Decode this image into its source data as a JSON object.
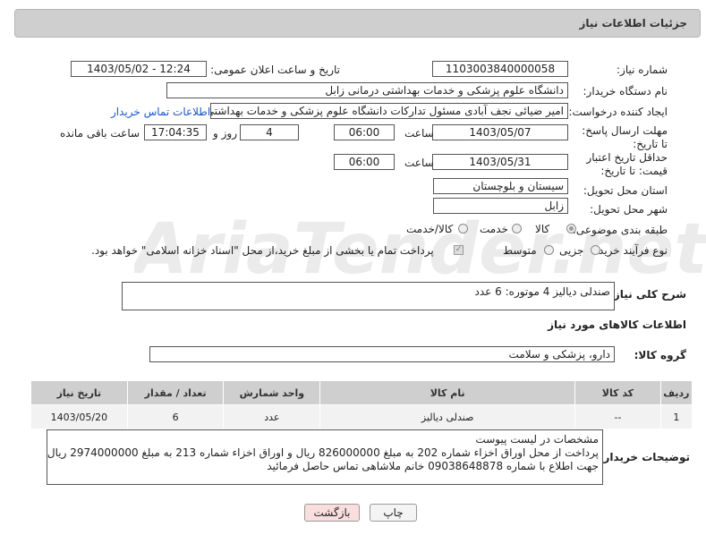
{
  "header": {
    "title": "جزئیات اطلاعات نیاز"
  },
  "fields": {
    "need_number_label": "شماره نیاز:",
    "need_number": "1103003840000058",
    "announce_label": "تاریخ و ساعت اعلان عمومی:",
    "announce_value": "1403/05/02 - 12:24",
    "buyer_org_label": "نام دستگاه خریدار:",
    "buyer_org": "دانشگاه علوم پزشکی و خدمات بهداشتی درمانی زابل",
    "creator_label": "ایجاد کننده درخواست:",
    "creator": "امیر ضیائی نجف آبادی مسئول تدارکات  دانشگاه علوم پزشکی و خدمات بهداشتی درمانی زابل",
    "contact_link": "اطلاعات تماس خریدار",
    "deadline_label": "مهلت ارسال پاسخ: تا تاریخ:",
    "deadline_date": "1403/05/07",
    "time_label": "ساعت",
    "deadline_time": "06:00",
    "days_value": "4",
    "days_label": "روز و",
    "remaining_time": "17:04:35",
    "remaining_label": "ساعت باقی مانده",
    "validity_label": "حداقل تاریخ اعتبار قیمت: تا تاریخ:",
    "validity_date": "1403/05/31",
    "validity_time": "06:00",
    "province_label": "استان محل تحویل:",
    "province": "سیستان و بلوچستان",
    "city_label": "شهر محل تحویل:",
    "city": "زابل",
    "category_label": "طبقه بندی موضوعی:",
    "category_options": [
      "کالا",
      "خدمت",
      "کالا/خدمت"
    ],
    "process_label": "نوع فرآیند خرید :",
    "process_options": [
      "جزیی",
      "متوسط"
    ],
    "payment_note": "پرداخت تمام یا بخشی از مبلغ خرید،از محل \"اسناد خزانه اسلامی\" خواهد بود."
  },
  "summary": {
    "label": "شرح کلی نیاز:",
    "value": "صندلی دیالیز 4 موتوره: 6 عدد"
  },
  "goods": {
    "section_title": "اطلاعات کالاهای مورد نیاز",
    "group_label": "گروه کالا:",
    "group_value": "دارو، پزشکی و سلامت",
    "columns": [
      "ردیف",
      "کد کالا",
      "نام کالا",
      "واحد شمارش",
      "تعداد / مقدار",
      "تاریخ نیاز"
    ],
    "rows": [
      {
        "row": "1",
        "code": "--",
        "name": "صندلی دیالیز",
        "unit": "عدد",
        "qty": "6",
        "date": "1403/05/20"
      }
    ]
  },
  "buyer_notes": {
    "label": "توضیحات خریدار:",
    "line1": "مشخصات در لیست پیوست",
    "line2": "پرداخت از محل اوراق اخزاء شماره 202 به مبلغ 826000000 ریال  و اوراق اخزاء شماره 213 به مبلغ 2974000000 ریال",
    "line3": "جهت اطلاع با شماره   09038648878 خانم ملاشاهی تماس حاصل فرمائید"
  },
  "buttons": {
    "print": "چاپ",
    "back": "بازگشت"
  },
  "watermark": "AriaTender.net",
  "colors": {
    "header_bg": "#cfcfcf",
    "link": "#1a56c8",
    "back_button_bg": "#f9dede"
  }
}
